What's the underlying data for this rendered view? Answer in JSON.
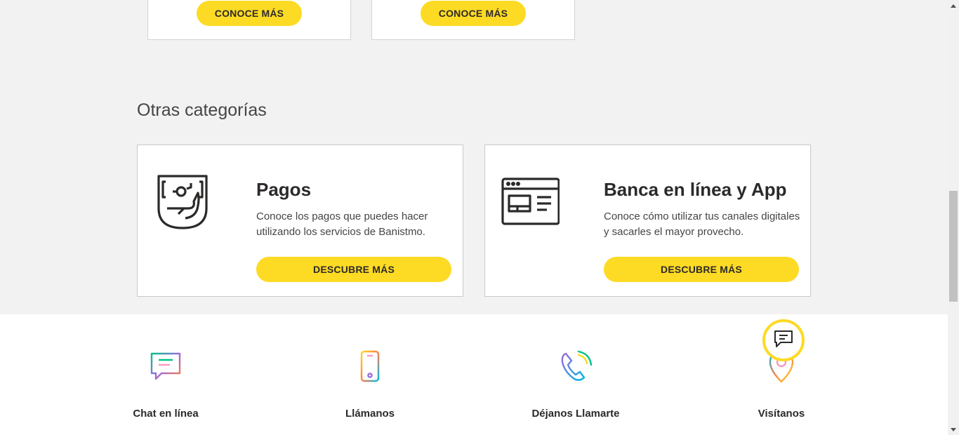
{
  "top_cards": [
    {
      "button_label": "CONOCE MÁS"
    },
    {
      "button_label": "CONOCE MÁS"
    }
  ],
  "other_categories": {
    "title": "Otras categorías",
    "cards": [
      {
        "icon": "payment-terminal-icon",
        "title": "Pagos",
        "description": "Conoce los pagos que puedes hacer utilizando los servicios de Banistmo.",
        "button_label": "DESCUBRE MÁS"
      },
      {
        "icon": "browser-window-icon",
        "title": "Banca en línea y App",
        "description": "Conoce cómo utilizar tus canales digitales y sacarles el mayor provecho.",
        "button_label": "DESCUBRE MÁS"
      }
    ]
  },
  "contact_options": [
    {
      "icon": "chat-bubble-icon",
      "label": "Chat en línea"
    },
    {
      "icon": "smartphone-icon",
      "label": "Llámanos"
    },
    {
      "icon": "phone-callback-icon",
      "label": "Déjanos Llamarte"
    },
    {
      "icon": "location-pin-icon",
      "label": "Visítanos"
    }
  ],
  "chat_fab": {
    "icon": "chat-message-icon"
  },
  "colors": {
    "accent_yellow": "#fdda24",
    "text_dark": "#2c2a29",
    "background": "#f2f2f2"
  }
}
